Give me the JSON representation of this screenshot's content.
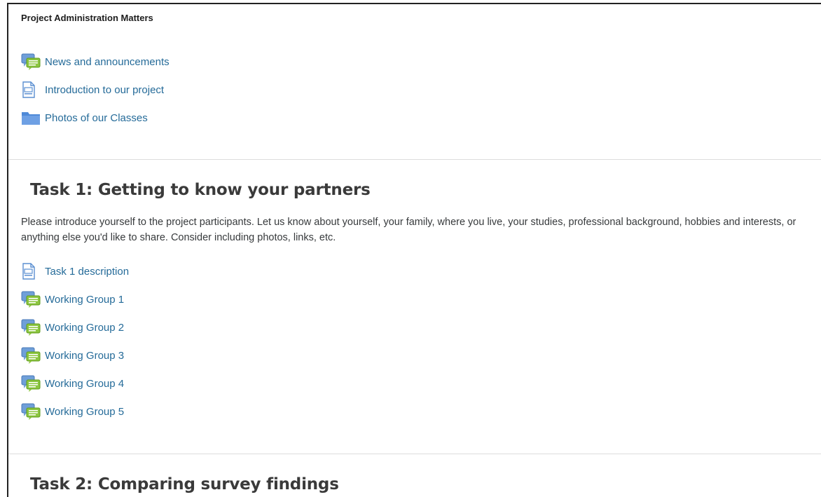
{
  "admin_section": {
    "title": "Project Administration Matters",
    "items": [
      {
        "label": "News and announcements",
        "icon": "forum-icon"
      },
      {
        "label": "Introduction to our project",
        "icon": "page-icon"
      },
      {
        "label": "Photos of our Classes",
        "icon": "folder-icon"
      }
    ]
  },
  "task1": {
    "title": "Task 1: Getting to know your partners",
    "summary": "Please introduce yourself to the project participants. Let us know about yourself, your family, where you live, your studies, professional background, hobbies and interests, or anything else you'd like to share. Consider including photos, links, etc.",
    "items": [
      {
        "label": "Task 1 description",
        "icon": "page-icon"
      },
      {
        "label": "Working Group 1",
        "icon": "forum-icon"
      },
      {
        "label": "Working Group 2",
        "icon": "forum-icon"
      },
      {
        "label": "Working Group 3",
        "icon": "forum-icon"
      },
      {
        "label": "Working Group 4",
        "icon": "forum-icon"
      },
      {
        "label": "Working Group 5",
        "icon": "forum-icon"
      }
    ]
  },
  "task2": {
    "title": "Task 2: Comparing survey findings"
  },
  "colors": {
    "link": "#256b99",
    "forum_blue": "#6f9fd8",
    "forum_green": "#8cc63f",
    "page_blue": "#5b8fd1",
    "folder_blue": "#4f8ad8"
  }
}
